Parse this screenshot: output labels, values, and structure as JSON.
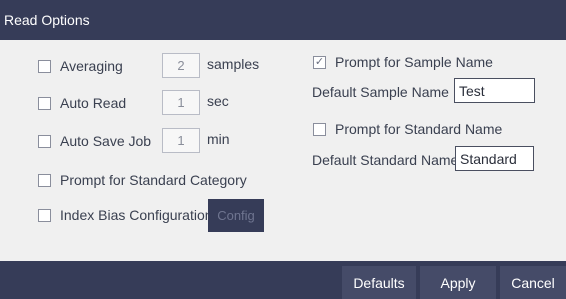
{
  "dialog": {
    "title": "Read Options"
  },
  "options": {
    "averaging": {
      "label": "Averaging",
      "checked": false,
      "value": "2",
      "unit": "samples"
    },
    "auto_read": {
      "label": "Auto Read",
      "checked": false,
      "value": "1",
      "unit": "sec"
    },
    "auto_save_job": {
      "label": "Auto Save Job",
      "checked": false,
      "value": "1",
      "unit": "min"
    },
    "prompt_standard_category": {
      "label": "Prompt for Standard Category",
      "checked": false
    },
    "index_bias": {
      "label": "Index Bias Configuration",
      "checked": false,
      "button_label": "Config"
    },
    "prompt_sample_name": {
      "label": "Prompt for Sample Name",
      "checked": true,
      "check_glyph": "✓"
    },
    "default_sample_name": {
      "label": "Default Sample Name",
      "value": "Test"
    },
    "prompt_standard_name": {
      "label": "Prompt for Standard Name",
      "checked": false
    },
    "default_standard_name": {
      "label": "Default Standard Name",
      "value": "Standard"
    }
  },
  "footer": {
    "defaults_label": "Defaults",
    "apply_label": "Apply",
    "cancel_label": "Cancel"
  },
  "colors": {
    "title_bar": "#363c58",
    "footer_button": "#454b68",
    "content_bg": "#f0f0f0"
  },
  "icons": {
    "checkbox_checked": "check-icon"
  }
}
